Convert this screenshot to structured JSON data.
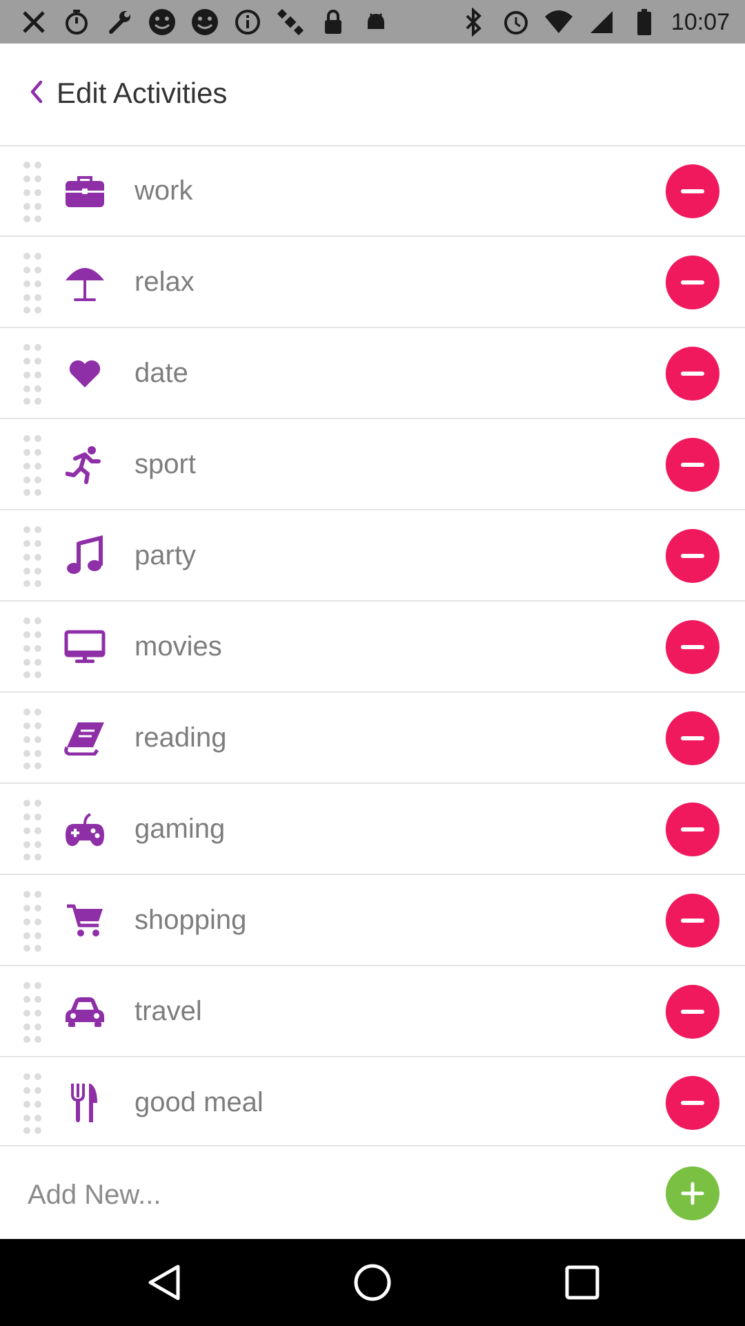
{
  "status_bar": {
    "time": "10:07",
    "left_icons": [
      "tools-icon",
      "timer-icon",
      "wrench-icon",
      "smiley-icon",
      "smiley-icon",
      "info-icon",
      "satellite-icon",
      "lock-icon",
      "android-icon"
    ],
    "right_icons": [
      "bluetooth-icon",
      "alarm-icon",
      "wifi-icon",
      "signal-icon",
      "battery-icon"
    ]
  },
  "header": {
    "title": "Edit Activities"
  },
  "colors": {
    "accent": "#8e2fa8",
    "remove": "#f0195d",
    "add": "#7ac143"
  },
  "activities": [
    {
      "label": "work",
      "icon": "briefcase-icon"
    },
    {
      "label": "relax",
      "icon": "umbrella-icon"
    },
    {
      "label": "date",
      "icon": "heart-icon"
    },
    {
      "label": "sport",
      "icon": "running-icon"
    },
    {
      "label": "party",
      "icon": "music-note-icon"
    },
    {
      "label": "movies",
      "icon": "monitor-icon"
    },
    {
      "label": "reading",
      "icon": "book-icon"
    },
    {
      "label": "gaming",
      "icon": "gamepad-icon"
    },
    {
      "label": "shopping",
      "icon": "cart-icon"
    },
    {
      "label": "travel",
      "icon": "car-icon"
    },
    {
      "label": "good meal",
      "icon": "fork-knife-icon"
    }
  ],
  "add_new": {
    "placeholder": "Add New..."
  },
  "nav": [
    "back-nav-icon",
    "home-nav-icon",
    "recents-nav-icon"
  ]
}
